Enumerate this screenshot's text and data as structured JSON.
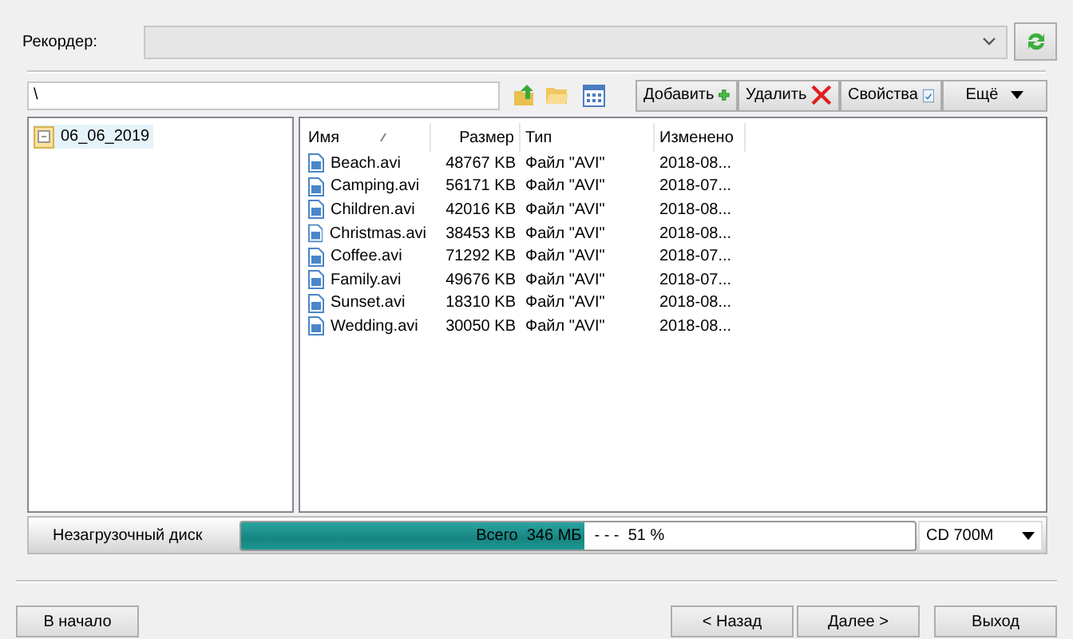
{
  "recorder": {
    "label": "Рекордер:"
  },
  "path": {
    "value": "\\"
  },
  "toolbar": {
    "buttons": [
      {
        "label": "Добавить",
        "kind": "add"
      },
      {
        "label": "Удалить",
        "kind": "delete"
      },
      {
        "label": "Свойства",
        "kind": "properties"
      },
      {
        "label": "Ещё",
        "kind": "more"
      }
    ]
  },
  "tree": {
    "items": [
      {
        "label": "06_06_2019",
        "selected": true
      }
    ]
  },
  "table": {
    "columns": [
      "Имя",
      "Размер",
      "Тип",
      "Изменено"
    ],
    "rows": [
      [
        "Beach.avi",
        "48767 KB",
        "Файл \"AVI\"",
        "2018-08..."
      ],
      [
        "Camping.avi",
        "56171 KB",
        "Файл \"AVI\"",
        "2018-07..."
      ],
      [
        "Children.avi",
        "42016 KB",
        "Файл \"AVI\"",
        "2018-08..."
      ],
      [
        "Christmas.avi",
        "38453 KB",
        "Файл \"AVI\"",
        "2018-08..."
      ],
      [
        "Coffee.avi",
        "71292 KB",
        "Файл \"AVI\"",
        "2018-07..."
      ],
      [
        "Family.avi",
        "49676 KB",
        "Файл \"AVI\"",
        "2018-07..."
      ],
      [
        "Sunset.avi",
        "18310 KB",
        "Файл \"AVI\"",
        "2018-08..."
      ],
      [
        "Wedding.avi",
        "30050 KB",
        "Файл \"AVI\"",
        "2018-08..."
      ]
    ]
  },
  "status_bar": {
    "disc_type": "Незагрузочный диск",
    "progress": {
      "level": 0.51,
      "total": "Всего  346 МБ",
      "percent": "- - -  51 %"
    },
    "media": "CD 700M"
  },
  "buttons": [
    {
      "label": "В начало",
      "kind": "left"
    },
    {
      "label": "< Назад",
      "kind": "right"
    },
    {
      "label": "Далее >",
      "kind": "right"
    },
    {
      "label": "Выход",
      "kind": "exit"
    }
  ]
}
